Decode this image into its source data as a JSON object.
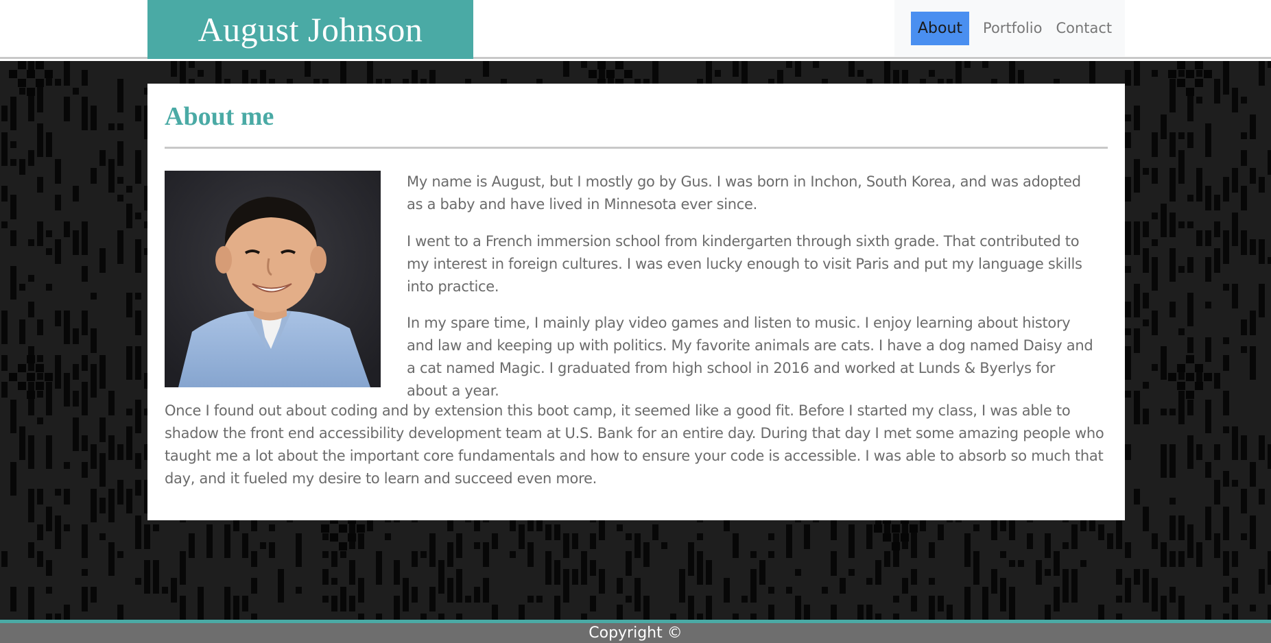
{
  "header": {
    "brand_title": "August Johnson",
    "nav": [
      {
        "label": "About",
        "active": true
      },
      {
        "label": "Portfolio",
        "active": false
      },
      {
        "label": "Contact",
        "active": false
      }
    ]
  },
  "main": {
    "section_title": "About me",
    "photo_alt": "portrait-photo",
    "paragraphs": [
      "My name is August, but I mostly go by Gus. I was born in Inchon, South Korea, and was adopted as a baby and have lived in Minnesota ever since.",
      "I went to a French immersion school from kindergarten through sixth grade. That contributed to my interest in foreign cultures. I was even lucky enough to visit Paris and put my language skills into practice.",
      "In my spare time, I mainly play video games and listen to music. I enjoy learning about history and law and keeping up with politics. My favorite animals are cats. I have a dog named Daisy and a cat named Magic. I graduated from high school in 2016 and worked at Lunds & Byerlys for about a year.",
      "Once I found out about coding and by extension this boot camp, it seemed like a good fit. Before I started my class, I was able to shadow the front end accessibility development team at U.S. Bank for an entire day. During that day I met some amazing people who taught me a lot about the important core fundamentals and how to ensure your code is accessible. I was able to absorb so much that day, and it fueled my desire to learn and succeed even more."
    ]
  },
  "footer": {
    "copyright": "Copyright ©"
  },
  "colors": {
    "accent": "#4aaaa5",
    "nav_active": "#4a8ff0",
    "background_pattern": "#1e1e1e",
    "footer": "#6e6e6e"
  }
}
